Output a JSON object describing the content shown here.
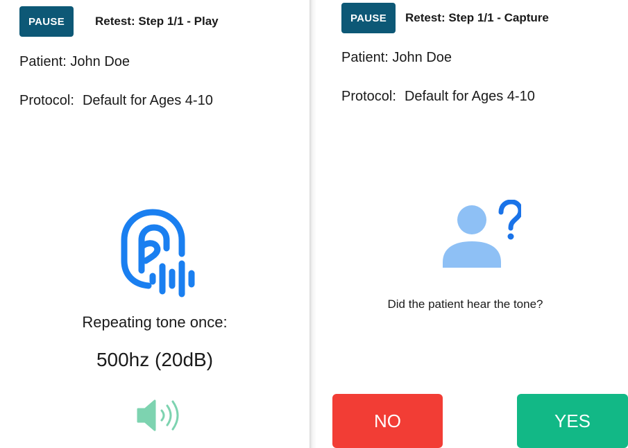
{
  "left_panel": {
    "pause_label": "PAUSE",
    "step_title": "Retest: Step 1/1 - Play",
    "patient_label": "Patient:",
    "patient_name": "John Doe",
    "protocol_label": "Protocol:",
    "protocol_value": "Default for Ages 4-10",
    "repeat_text": "Repeating tone once:",
    "tone_text": "500hz (20dB)",
    "icons": {
      "main": "hearing-icon",
      "play": "speaker-icon"
    }
  },
  "right_panel": {
    "pause_label": "PAUSE",
    "step_title": "Retest: Step 1/1 - Capture",
    "patient_label": "Patient:",
    "patient_name": "John Doe",
    "protocol_label": "Protocol:",
    "protocol_value": "Default for Ages 4-10",
    "question": "Did the patient hear the tone?",
    "no_label": "NO",
    "yes_label": "YES",
    "icons": {
      "main": "person-question-icon"
    }
  },
  "colors": {
    "pause_bg": "#0d5876",
    "hearing_icon": "#1a7ff0",
    "speaker_icon": "#7dd3b0",
    "person_icon": "#8ec0f5",
    "question_mark": "#1a73e8",
    "no_button": "#f23d35",
    "yes_button": "#12b886"
  }
}
